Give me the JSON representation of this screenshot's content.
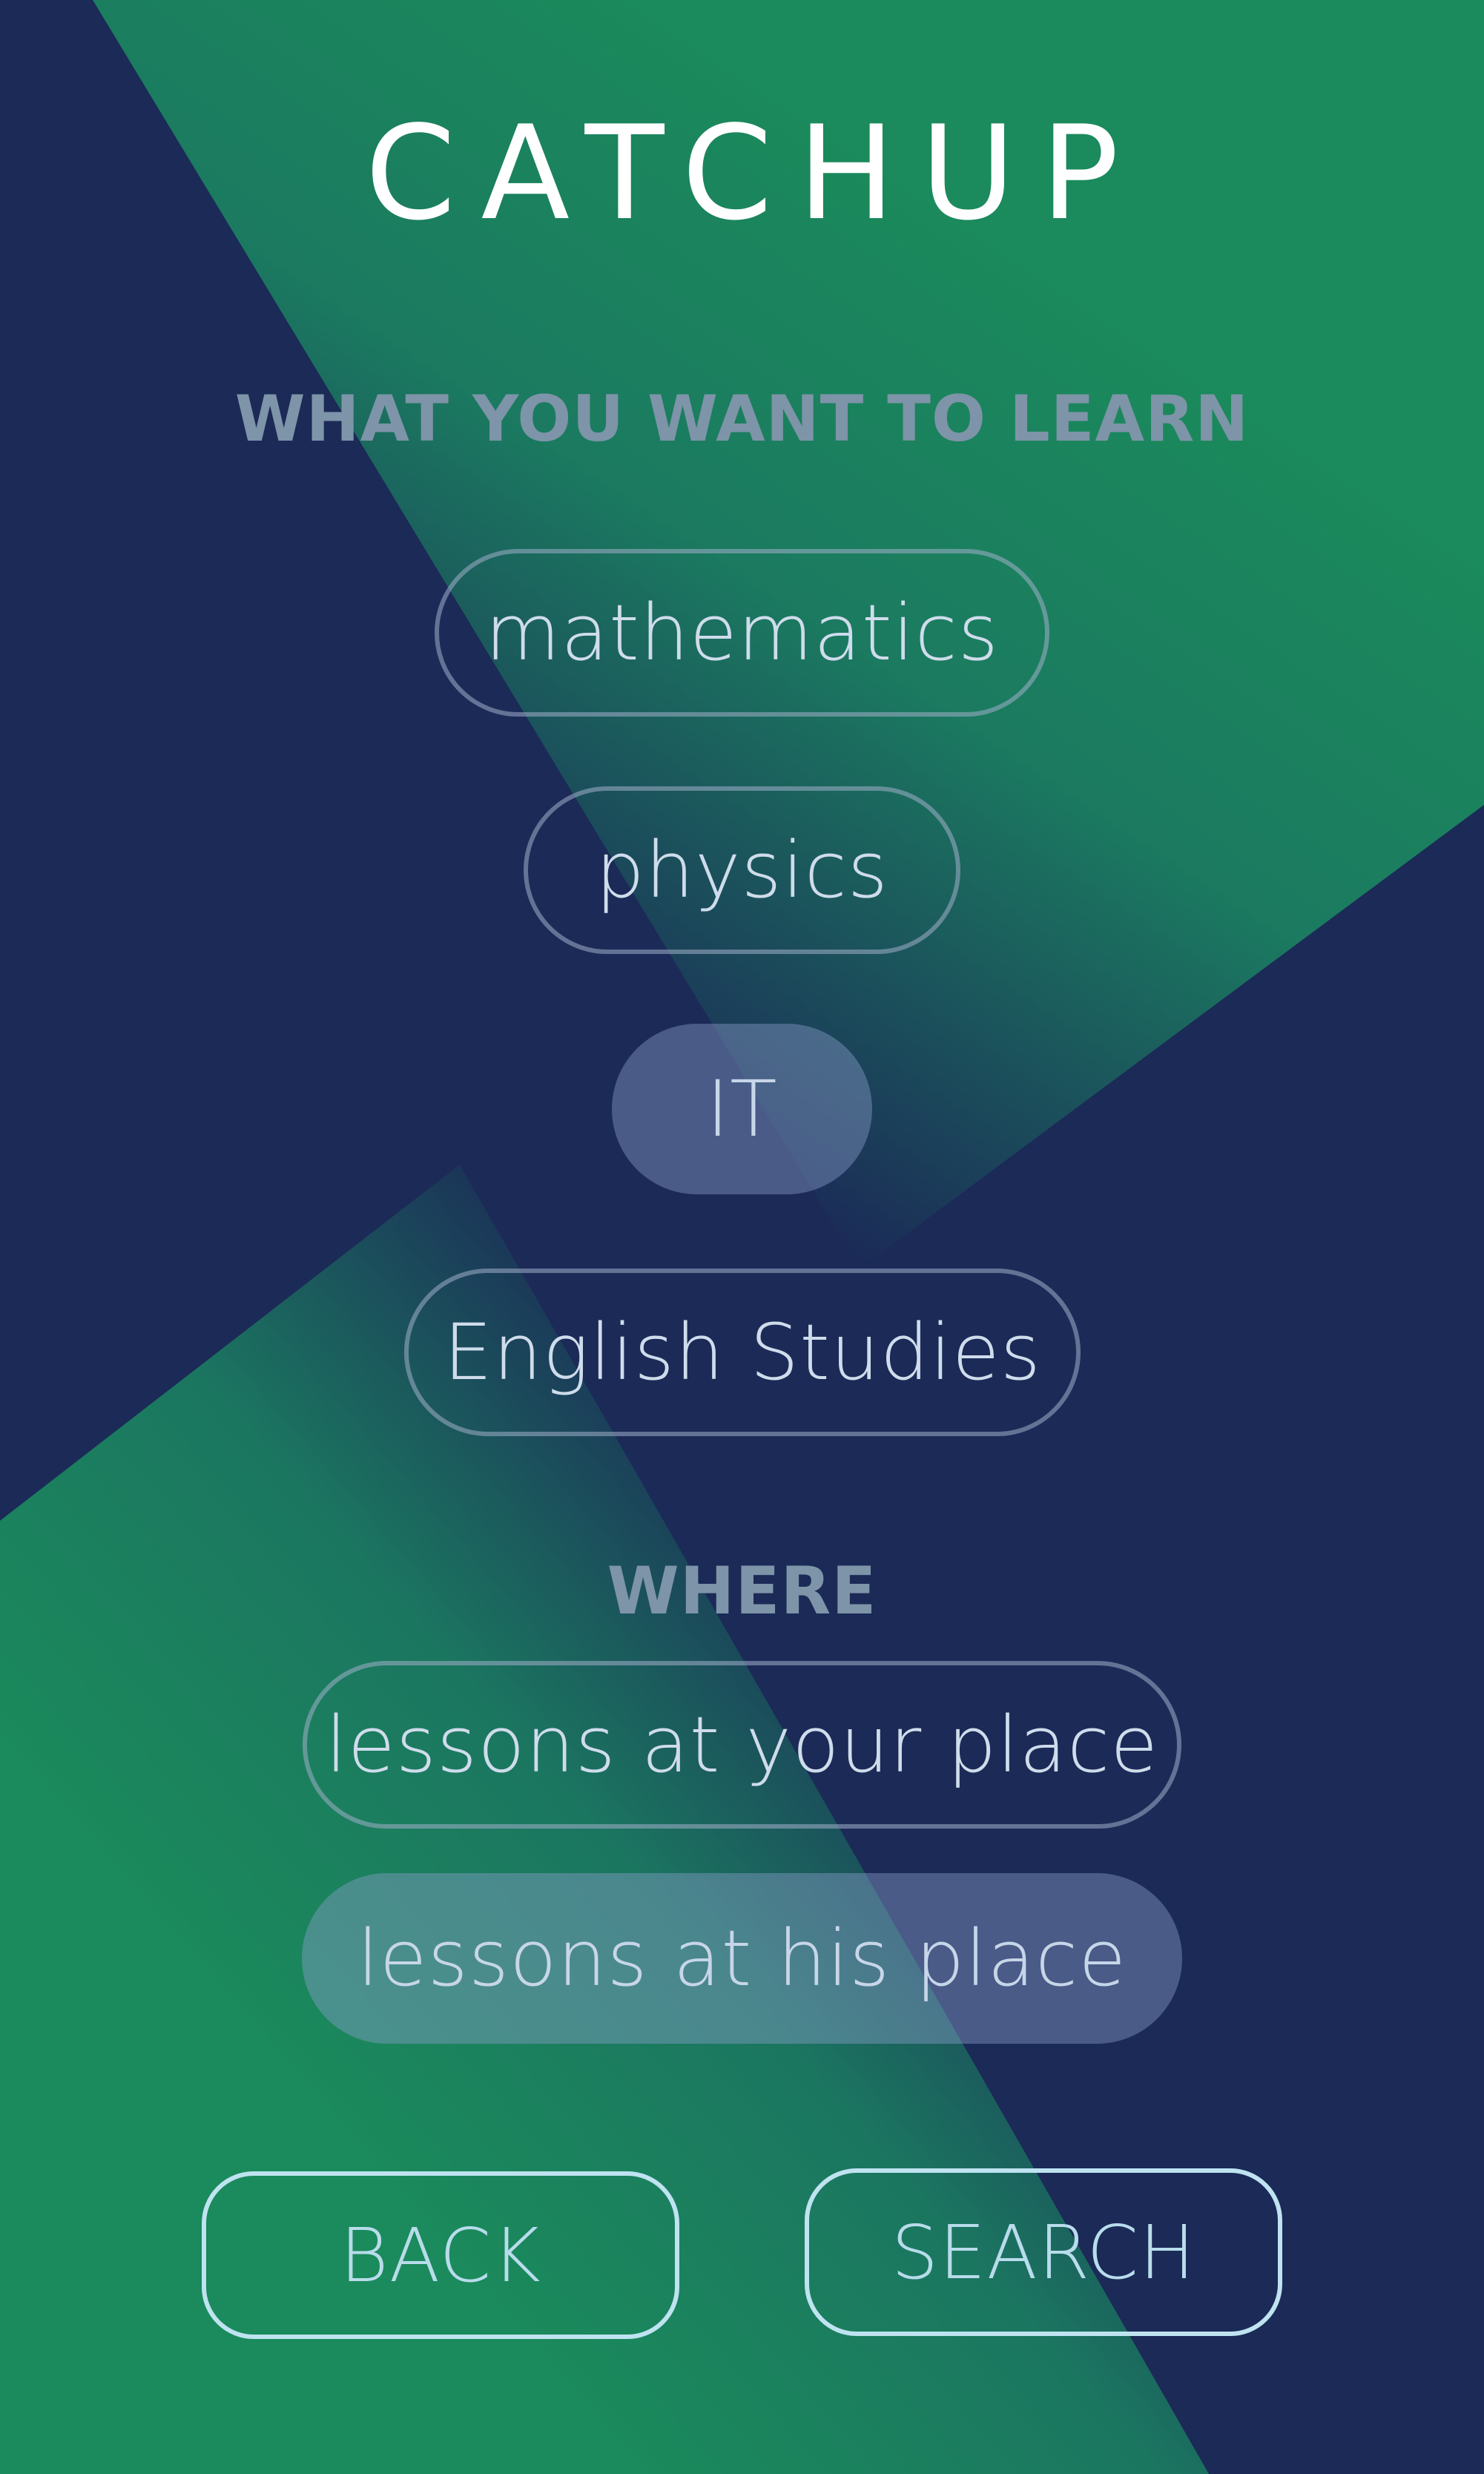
{
  "app": {
    "logo": "CATCHUP"
  },
  "learn": {
    "title": "WHAT YOU WANT TO LEARN",
    "subjects": [
      {
        "label": "mathematics",
        "selected": false
      },
      {
        "label": "physics",
        "selected": false
      },
      {
        "label": "IT",
        "selected": true
      },
      {
        "label": "English Studies",
        "selected": false
      }
    ]
  },
  "where": {
    "title": "WHERE",
    "options": [
      {
        "label": "lessons at your place",
        "selected": false
      },
      {
        "label": "lessons at his place",
        "selected": true
      }
    ]
  },
  "actions": {
    "back_label": "BACK",
    "search_label": "SEARCH"
  },
  "colors": {
    "navy": "#1b2a57",
    "green": "#1b8a5c",
    "title_text": "#7e94a8",
    "pill_text": "#cfdceb",
    "button_border": "#bfe3f0"
  }
}
